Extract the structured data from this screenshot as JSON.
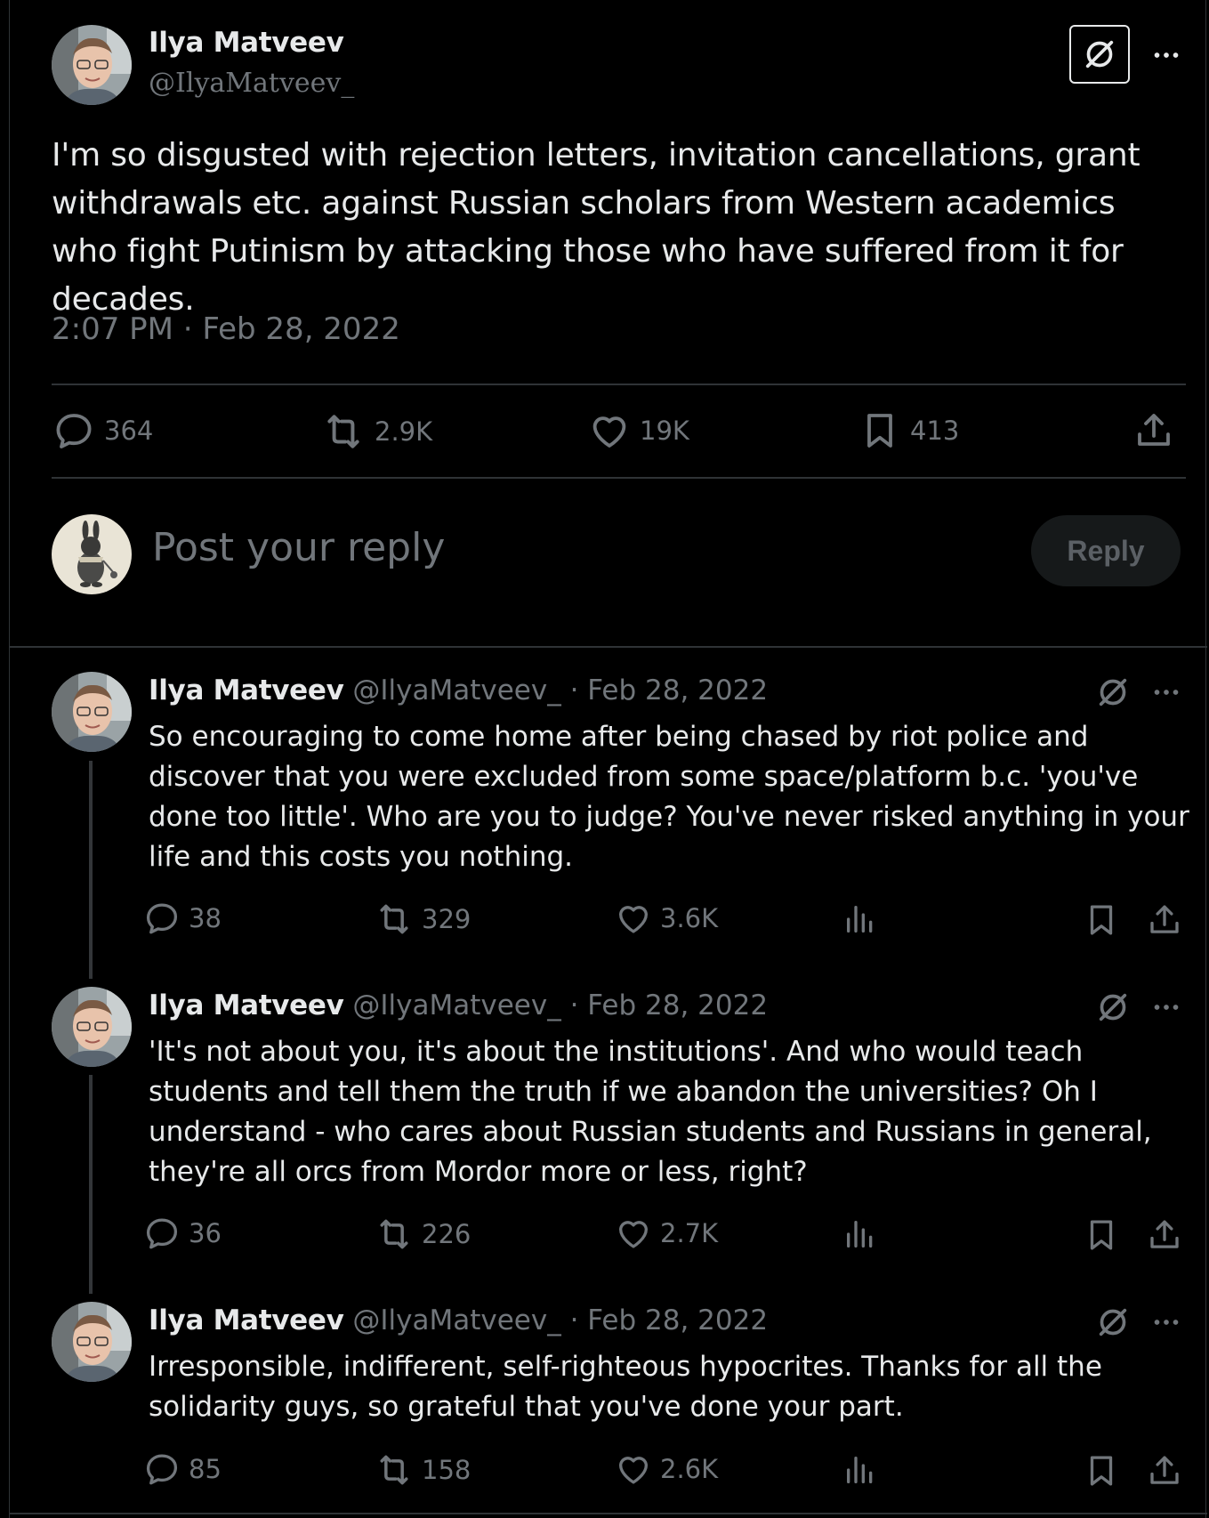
{
  "main_post": {
    "author_name": "Ilya Matveev",
    "handle": "@IlyaMatveev_",
    "text": "I'm so disgusted with rejection letters, invitation cancellations, grant withdrawals etc. against Russian scholars from Western academics who fight Putinism by attacking those who have suffered from it for decades.",
    "timestamp": "2:07 PM · Feb 28, 2022",
    "stats": {
      "replies": "364",
      "reposts": "2.9K",
      "likes": "19K",
      "bookmarks": "413"
    }
  },
  "reply_box": {
    "placeholder": "Post your reply",
    "button_label": "Reply"
  },
  "thread": [
    {
      "author_name": "Ilya Matveev",
      "meta": "@IlyaMatveev_ · Feb 28, 2022",
      "text": "So encouraging to come home after being chased by riot police and discover that you were excluded from some space/platform b.c. 'you've done too little'. Who are you to judge? You've never risked anything in your life and this costs you nothing.",
      "replies": "38",
      "reposts": "329",
      "likes": "3.6K"
    },
    {
      "author_name": "Ilya Matveev",
      "meta": "@IlyaMatveev_ · Feb 28, 2022",
      "text": "'It's not about you, it's about the institutions'. And who would teach students and tell them the truth if we abandon the universities? Oh I understand - who cares about Russian students and Russians in general, they're all orcs from Mordor more or less, right?",
      "replies": "36",
      "reposts": "226",
      "likes": "2.7K"
    },
    {
      "author_name": "Ilya Matveev",
      "meta": "@IlyaMatveev_ · Feb 28, 2022",
      "text": "Irresponsible, indifferent, self-righteous hypocrites. Thanks for all the solidarity guys, so grateful that you've done your part.",
      "replies": "85",
      "reposts": "158",
      "likes": "2.6K"
    }
  ],
  "colors": {
    "background": "#000000",
    "text": "#e7e9ea",
    "secondary": "#71767b",
    "divider": "#2f3336"
  },
  "icons": [
    "grok-icon",
    "more-icon",
    "reply-icon",
    "repost-icon",
    "like-icon",
    "bookmark-icon",
    "share-icon",
    "views-icon"
  ]
}
